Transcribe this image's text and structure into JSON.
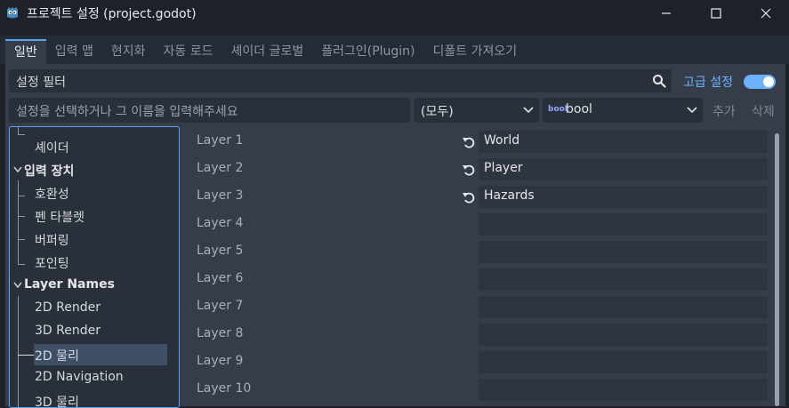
{
  "window": {
    "title": "프로젝트 설정 (project.godot)",
    "icon": "godot-icon"
  },
  "tabs": [
    {
      "label": "일반",
      "active": true
    },
    {
      "label": "입력 맵"
    },
    {
      "label": "현지화"
    },
    {
      "label": "자동 로드"
    },
    {
      "label": "셰이더 글로벌"
    },
    {
      "label": "플러그인(Plugin)"
    },
    {
      "label": "디폴트 가져오기"
    }
  ],
  "filter": {
    "value": "설정 필터",
    "advanced_label": "고급 설정",
    "advanced_enabled": true
  },
  "add_bar": {
    "property_placeholder": "설정을 선택하거나 그 이름을 입력해주세요",
    "feature_value": "(모두)",
    "type_icon": "bool",
    "type_value": "bool",
    "add_label": "추가",
    "delete_label": "삭제"
  },
  "tree": [
    {
      "label": "셰이더",
      "kind": "child"
    },
    {
      "label": "입력 장치",
      "kind": "section"
    },
    {
      "label": "호환성",
      "kind": "child"
    },
    {
      "label": "펜 타블렛",
      "kind": "child"
    },
    {
      "label": "버퍼링",
      "kind": "child"
    },
    {
      "label": "포인팅",
      "kind": "child"
    },
    {
      "label": "Layer Names",
      "kind": "section"
    },
    {
      "label": "2D Render",
      "kind": "child"
    },
    {
      "label": "3D Render",
      "kind": "child"
    },
    {
      "label": "2D 물리",
      "kind": "child",
      "selected": true
    },
    {
      "label": "2D Navigation",
      "kind": "child"
    },
    {
      "label": "3D 물리",
      "kind": "child"
    }
  ],
  "layers": [
    {
      "label": "Layer 1",
      "value": "World"
    },
    {
      "label": "Layer 2",
      "value": "Player"
    },
    {
      "label": "Layer 3",
      "value": "Hazards"
    },
    {
      "label": "Layer 4",
      "value": ""
    },
    {
      "label": "Layer 5",
      "value": ""
    },
    {
      "label": "Layer 6",
      "value": ""
    },
    {
      "label": "Layer 7",
      "value": ""
    },
    {
      "label": "Layer 8",
      "value": ""
    },
    {
      "label": "Layer 9",
      "value": ""
    },
    {
      "label": "Layer 10",
      "value": ""
    }
  ],
  "colors": {
    "accent": "#6cb2ff",
    "selection": "#3f5066"
  }
}
